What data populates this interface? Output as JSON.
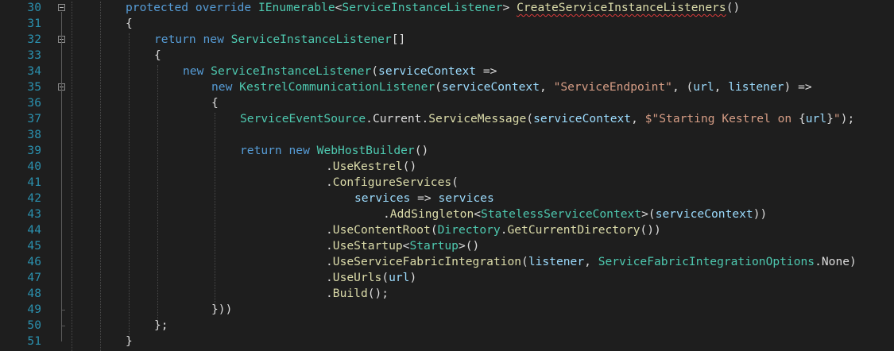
{
  "editor": {
    "lines": [
      {
        "number": "30",
        "tokens": [
          {
            "text": "protected",
            "c": "k"
          },
          {
            "text": " "
          },
          {
            "text": "override",
            "c": "k"
          },
          {
            "text": " "
          },
          {
            "text": "IEnumerable",
            "c": "t"
          },
          {
            "text": "<"
          },
          {
            "text": "ServiceInstanceListener",
            "c": "t"
          },
          {
            "text": "> "
          },
          {
            "text": "CreateServiceInstanceListeners",
            "c": "m",
            "squiggle": true
          },
          {
            "text": "()"
          }
        ]
      },
      {
        "number": "31",
        "tokens": [
          {
            "text": "{"
          }
        ]
      },
      {
        "number": "32",
        "tokens": [
          {
            "text": "return",
            "c": "k"
          },
          {
            "text": " "
          },
          {
            "text": "new",
            "c": "k"
          },
          {
            "text": " "
          },
          {
            "text": "ServiceInstanceListener",
            "c": "t"
          },
          {
            "text": "[]"
          }
        ]
      },
      {
        "number": "33",
        "tokens": [
          {
            "text": "{"
          }
        ]
      },
      {
        "number": "34",
        "tokens": [
          {
            "text": "new",
            "c": "k"
          },
          {
            "text": " "
          },
          {
            "text": "ServiceInstanceListener",
            "c": "t"
          },
          {
            "text": "("
          },
          {
            "text": "serviceContext",
            "c": "p"
          },
          {
            "text": " =>"
          }
        ]
      },
      {
        "number": "35",
        "tokens": [
          {
            "text": "new",
            "c": "k"
          },
          {
            "text": " "
          },
          {
            "text": "KestrelCommunicationListener",
            "c": "t"
          },
          {
            "text": "("
          },
          {
            "text": "serviceContext",
            "c": "p"
          },
          {
            "text": ", "
          },
          {
            "text": "\"ServiceEndpoint\"",
            "c": "s"
          },
          {
            "text": ", ("
          },
          {
            "text": "url",
            "c": "p"
          },
          {
            "text": ", "
          },
          {
            "text": "listener",
            "c": "p"
          },
          {
            "text": ") =>"
          }
        ]
      },
      {
        "number": "36",
        "tokens": [
          {
            "text": "{"
          }
        ]
      },
      {
        "number": "37",
        "tokens": [
          {
            "text": "ServiceEventSource",
            "c": "t"
          },
          {
            "text": "."
          },
          {
            "text": "Current"
          },
          {
            "text": "."
          },
          {
            "text": "ServiceMessage",
            "c": "m"
          },
          {
            "text": "("
          },
          {
            "text": "serviceContext",
            "c": "p"
          },
          {
            "text": ", "
          },
          {
            "text": "$\"Starting Kestrel on ",
            "c": "s"
          },
          {
            "text": "{"
          },
          {
            "text": "url",
            "c": "p"
          },
          {
            "text": "}"
          },
          {
            "text": "\"",
            "c": "s"
          },
          {
            "text": ");"
          }
        ]
      },
      {
        "number": "38",
        "tokens": []
      },
      {
        "number": "39",
        "tokens": [
          {
            "text": "return",
            "c": "k"
          },
          {
            "text": " "
          },
          {
            "text": "new",
            "c": "k"
          },
          {
            "text": " "
          },
          {
            "text": "WebHostBuilder",
            "c": "t"
          },
          {
            "text": "()"
          }
        ]
      },
      {
        "number": "40",
        "tokens": [
          {
            "text": "."
          },
          {
            "text": "UseKestrel",
            "c": "m"
          },
          {
            "text": "()"
          }
        ]
      },
      {
        "number": "41",
        "tokens": [
          {
            "text": "."
          },
          {
            "text": "ConfigureServices",
            "c": "m"
          },
          {
            "text": "("
          }
        ]
      },
      {
        "number": "42",
        "tokens": [
          {
            "text": "services",
            "c": "p"
          },
          {
            "text": " => "
          },
          {
            "text": "services",
            "c": "p"
          }
        ]
      },
      {
        "number": "43",
        "tokens": [
          {
            "text": "."
          },
          {
            "text": "AddSingleton",
            "c": "m"
          },
          {
            "text": "<"
          },
          {
            "text": "StatelessServiceContext",
            "c": "t"
          },
          {
            "text": ">("
          },
          {
            "text": "serviceContext",
            "c": "p"
          },
          {
            "text": "))"
          }
        ]
      },
      {
        "number": "44",
        "tokens": [
          {
            "text": "."
          },
          {
            "text": "UseContentRoot",
            "c": "m"
          },
          {
            "text": "("
          },
          {
            "text": "Directory",
            "c": "t"
          },
          {
            "text": "."
          },
          {
            "text": "GetCurrentDirectory",
            "c": "m"
          },
          {
            "text": "())"
          }
        ]
      },
      {
        "number": "45",
        "tokens": [
          {
            "text": "."
          },
          {
            "text": "UseStartup",
            "c": "m"
          },
          {
            "text": "<"
          },
          {
            "text": "Startup",
            "c": "t"
          },
          {
            "text": ">()"
          }
        ]
      },
      {
        "number": "46",
        "tokens": [
          {
            "text": "."
          },
          {
            "text": "UseServiceFabricIntegration",
            "c": "m"
          },
          {
            "text": "("
          },
          {
            "text": "listener",
            "c": "p"
          },
          {
            "text": ", "
          },
          {
            "text": "ServiceFabricIntegrationOptions",
            "c": "t"
          },
          {
            "text": "."
          },
          {
            "text": "None"
          },
          {
            "text": ")"
          }
        ]
      },
      {
        "number": "47",
        "tokens": [
          {
            "text": "."
          },
          {
            "text": "UseUrls",
            "c": "m"
          },
          {
            "text": "("
          },
          {
            "text": "url",
            "c": "p"
          },
          {
            "text": ")"
          }
        ]
      },
      {
        "number": "48",
        "tokens": [
          {
            "text": "."
          },
          {
            "text": "Build",
            "c": "m"
          },
          {
            "text": "();"
          }
        ]
      },
      {
        "number": "49",
        "tokens": [
          {
            "text": "}))"
          }
        ]
      },
      {
        "number": "50",
        "tokens": [
          {
            "text": "};"
          }
        ]
      },
      {
        "number": "51",
        "tokens": [
          {
            "text": "}"
          }
        ]
      }
    ]
  },
  "colors": {
    "background": "#1e1e1e",
    "line_number": "#2b91af",
    "keyword": "#569cd6",
    "type": "#4ec9b0",
    "string": "#d69d85",
    "parameter": "#9cdcfe",
    "method": "#dcdcaa",
    "text": "#dcdcdc"
  }
}
